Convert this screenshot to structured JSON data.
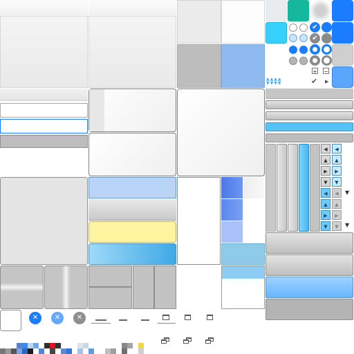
{
  "colors": {
    "accent_blue": "#1a7cff",
    "teal": "#16b89b",
    "sky": "#55c6f5",
    "pale_blue": "#b8d5f7",
    "yellow": "#fff4a0",
    "grey": "#bdbdbd"
  },
  "icons": {
    "check": "✔",
    "close": "✕",
    "arrow_left": "◀",
    "arrow_right": "▶",
    "arrow_up": "▲",
    "arrow_down": "▼",
    "plus": "+",
    "minus": "−",
    "window": "◻"
  },
  "tree": {
    "expand_label": "+",
    "collapse_label": "−"
  }
}
